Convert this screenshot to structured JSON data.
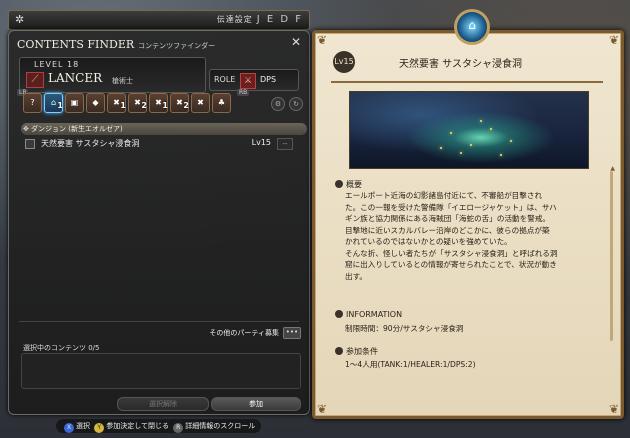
{
  "topbar": {
    "sensor_label": "伝達設定",
    "sensor_symbols": "J E D F"
  },
  "finder": {
    "title": "CONTENTS FINDER",
    "title_jp": "コンテンツファインダー",
    "level": "LEVEL 18",
    "job": "LANCER",
    "job_jp": "槍術士",
    "role_label": "ROLE",
    "role": "DPS",
    "lb": "LB",
    "rb": "RB",
    "tabs": [
      {
        "icon": "roulette",
        "num": ""
      },
      {
        "icon": "dungeon",
        "num": "1"
      },
      {
        "icon": "guildhest",
        "num": ""
      },
      {
        "icon": "trial",
        "num": ""
      },
      {
        "icon": "raid",
        "num": "1"
      },
      {
        "icon": "pvp",
        "num": "2"
      },
      {
        "icon": "raid2",
        "num": "1"
      },
      {
        "icon": "raid3",
        "num": "2"
      },
      {
        "icon": "gold-saucer",
        "num": ""
      },
      {
        "icon": "misc",
        "num": ""
      }
    ],
    "category": "ダンジョン (新生エオルゼア)",
    "duty_name": "天然要害 サスタシャ浸食洞",
    "duty_level": "Lv15",
    "duty_dropdown": "--",
    "party_recruit": "その他のパーティ募集",
    "party_more": "•••",
    "selected": "選択中のコンテンツ 0/5",
    "clear_button": "選択解除",
    "join_button": "参加"
  },
  "detail": {
    "level": "Lv15",
    "title": "天然要害 サスタシャ浸食洞",
    "overview_label": "概要",
    "overview": [
      "エールポート近海の幻影諸島付近にて、不審船が目撃され",
      "た。この一報を受けた警備隊「イエロージャケット」は、サハ",
      "ギン族と協力関係にある海賊団「海蛇の舌」の活動を警戒。",
      "目撃地に近いスカルバレー沿岸のどこかに、彼らの拠点が築",
      "かれているのではないかとの疑いを強めていた。",
      "そんな折、怪しい者たちが「サスタシャ浸食洞」と呼ばれる洞",
      "窟に出入りしているとの情報が寄せられたことで、状況が動き",
      "出す。"
    ],
    "info_label": "INFORMATION",
    "info": "制限時間：90分/サスタシャ浸食洞",
    "cond_label": "参加条件",
    "cond": "1～4人用(TANK:1/HEALER:1/DPS:2)"
  },
  "hint": {
    "select": "選択",
    "confirm": "参加決定して閉じる",
    "scroll": "詳細情報のスクロール",
    "key_x": "X",
    "key_y": "Y",
    "key_r": "R"
  }
}
